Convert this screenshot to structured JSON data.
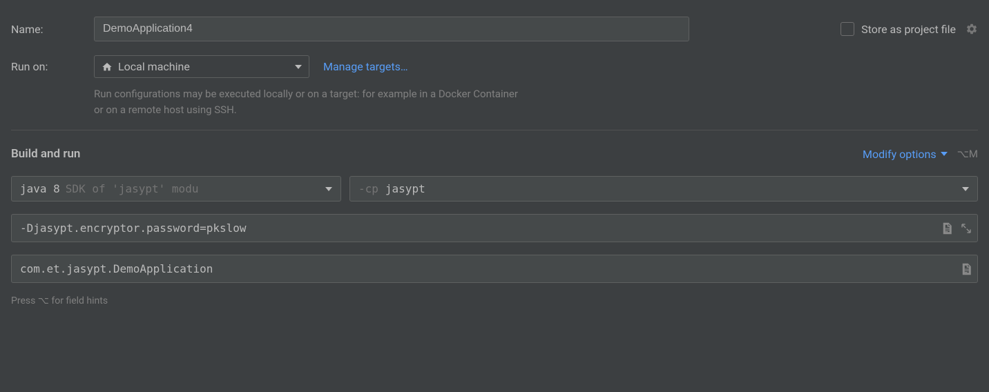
{
  "name": {
    "label": "Name:",
    "value": "DemoApplication4"
  },
  "store_as_project_file": {
    "label": "Store as project file",
    "checked": false
  },
  "run_on": {
    "label": "Run on:",
    "selected": "Local machine",
    "manage_link": "Manage targets…",
    "hint": "Run configurations may be executed locally or on a target: for example in a Docker Container or on a remote host using SSH."
  },
  "build_and_run": {
    "title": "Build and run",
    "modify_options": "Modify options",
    "shortcut": "⌥M",
    "sdk": {
      "primary": "java 8",
      "secondary": "SDK of 'jasypt' modu"
    },
    "classpath": {
      "flag": "-cp",
      "value": "jasypt"
    },
    "vm_options": "-Djasypt.encryptor.password=pkslow",
    "main_class": "com.et.jasypt.DemoApplication"
  },
  "footer_hint": "Press ⌥ for field hints"
}
